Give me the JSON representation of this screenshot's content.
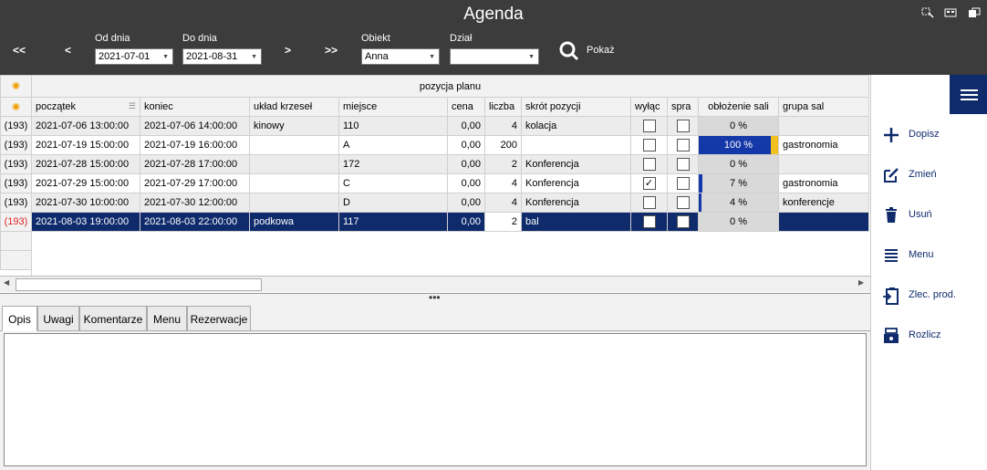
{
  "window": {
    "title": "Agenda"
  },
  "toolbar": {
    "nav_first": "<<",
    "nav_prev": "<",
    "nav_next": ">",
    "nav_last": ">>",
    "from_label": "Od dnia",
    "from_value": "2021-07-01",
    "to_label": "Do dnia",
    "to_value": "2021-08-31",
    "object_label": "Obiekt",
    "object_value": "Anna",
    "dept_label": "Dział",
    "dept_value": "",
    "show_label": "Pokaż"
  },
  "grid": {
    "group_header": "pozycja planu",
    "columns": [
      "początek",
      "koniec",
      "układ krzeseł",
      "miejsce",
      "cena",
      "liczba",
      "skrót pozycji",
      "wyłąc",
      "spra",
      "obłożenie sali",
      "grupa sal"
    ],
    "rows": [
      {
        "idx": "(193)",
        "start": "2021-07-06 13:00:00",
        "end": "2021-07-06 14:00:00",
        "layout": "kinowy",
        "place": "110",
        "price": "0,00",
        "count": "4",
        "short": "kolacja",
        "excluded": false,
        "checked": false,
        "occupancy": "0 %",
        "occupancy_value": 0,
        "group": ""
      },
      {
        "idx": "(193)",
        "start": "2021-07-19 15:00:00",
        "end": "2021-07-19 16:00:00",
        "layout": "",
        "place": "A",
        "price": "0,00",
        "count": "200",
        "short": "",
        "excluded": false,
        "checked": false,
        "occupancy": "100 %",
        "occupancy_value": 100,
        "group": "gastronomia"
      },
      {
        "idx": "(193)",
        "start": "2021-07-28 15:00:00",
        "end": "2021-07-28 17:00:00",
        "layout": "",
        "place": "172",
        "price": "0,00",
        "count": "2",
        "short": "Konferencja",
        "excluded": false,
        "checked": false,
        "occupancy": "0 %",
        "occupancy_value": 0,
        "group": ""
      },
      {
        "idx": "(193)",
        "start": "2021-07-29 15:00:00",
        "end": "2021-07-29 17:00:00",
        "layout": "",
        "place": "C",
        "price": "0,00",
        "count": "4",
        "short": "Konferencja",
        "excluded": true,
        "checked": false,
        "occupancy": "7 %",
        "occupancy_value": 7,
        "group": "gastronomia"
      },
      {
        "idx": "(193)",
        "start": "2021-07-30 10:00:00",
        "end": "2021-07-30 12:00:00",
        "layout": "",
        "place": "D",
        "price": "0,00",
        "count": "4",
        "short": "Konferencja",
        "excluded": false,
        "checked": false,
        "occupancy": "4 %",
        "occupancy_value": 4,
        "group": "konferencje"
      },
      {
        "idx": "(193)",
        "start": "2021-08-03 19:00:00",
        "end": "2021-08-03 22:00:00",
        "layout": "podkowa",
        "place": "117",
        "price": "0,00",
        "count": "2",
        "short": "bal",
        "excluded": false,
        "checked": false,
        "occupancy": "0 %",
        "occupancy_value": 0,
        "group": ""
      }
    ]
  },
  "tabs": [
    "Opis",
    "Uwagi",
    "Komentarze",
    "Menu",
    "Rezerwacje"
  ],
  "side": {
    "add": "Dopisz",
    "edit": "Zmień",
    "delete": "Usuń",
    "menu": "Menu",
    "order": "Zlec. prod.",
    "settle": "Rozlicz"
  },
  "colors": {
    "topbar": "#3c3c3c",
    "selection": "#0f2b6c",
    "occupancy": "#1538a8",
    "marker": "#f0c020"
  }
}
